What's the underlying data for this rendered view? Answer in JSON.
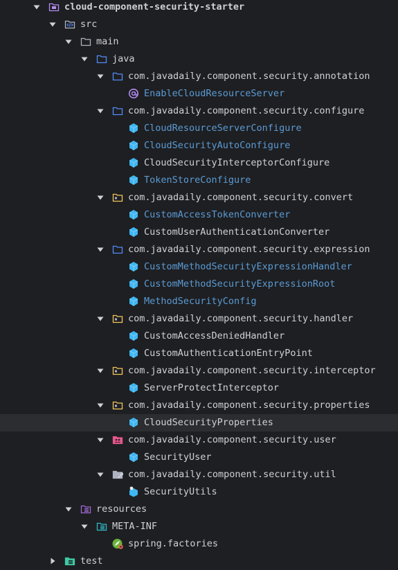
{
  "tree": {
    "nodes": [
      {
        "label": "cloud-component-security-starter",
        "icon": "module-folder-icon",
        "expand": "expanded",
        "level": 0,
        "color": "white",
        "bold": true
      },
      {
        "label": "src",
        "icon": "source-folder-icon",
        "expand": "expanded",
        "level": 1,
        "color": "white"
      },
      {
        "label": "main",
        "icon": "folder-icon",
        "expand": "expanded",
        "level": 2,
        "color": "white"
      },
      {
        "label": "java",
        "icon": "java-source-root-icon",
        "expand": "expanded",
        "level": 3,
        "color": "white"
      },
      {
        "label": "com.javadaily.component.security.annotation",
        "icon": "package-icon",
        "expand": "expanded",
        "level": 4,
        "color": "white"
      },
      {
        "label": "EnableCloudResourceServer",
        "icon": "annotation-icon",
        "expand": "none",
        "level": 5,
        "color": "blue"
      },
      {
        "label": "com.javadaily.component.security.configure",
        "icon": "package-icon",
        "expand": "expanded",
        "level": 4,
        "color": "white"
      },
      {
        "label": "CloudResourceServerConfigure",
        "icon": "class-icon",
        "expand": "none",
        "level": 5,
        "color": "blue"
      },
      {
        "label": "CloudSecurityAutoConfigure",
        "icon": "class-icon",
        "expand": "none",
        "level": 5,
        "color": "blue"
      },
      {
        "label": "CloudSecurityInterceptorConfigure",
        "icon": "class-icon",
        "expand": "none",
        "level": 5,
        "color": "white"
      },
      {
        "label": "TokenStoreConfigure",
        "icon": "class-icon",
        "expand": "none",
        "level": 5,
        "color": "blue"
      },
      {
        "label": "com.javadaily.component.security.convert",
        "icon": "package-yellow-icon",
        "expand": "expanded",
        "level": 4,
        "color": "white"
      },
      {
        "label": "CustomAccessTokenConverter",
        "icon": "class-icon",
        "expand": "none",
        "level": 5,
        "color": "blue"
      },
      {
        "label": "CustomUserAuthenticationConverter",
        "icon": "class-icon",
        "expand": "none",
        "level": 5,
        "color": "white"
      },
      {
        "label": "com.javadaily.component.security.expression",
        "icon": "package-icon",
        "expand": "expanded",
        "level": 4,
        "color": "white"
      },
      {
        "label": "CustomMethodSecurityExpressionHandler",
        "icon": "class-icon",
        "expand": "none",
        "level": 5,
        "color": "blue"
      },
      {
        "label": "CustomMethodSecurityExpressionRoot",
        "icon": "class-icon",
        "expand": "none",
        "level": 5,
        "color": "blue"
      },
      {
        "label": "MethodSecurityConfig",
        "icon": "class-icon",
        "expand": "none",
        "level": 5,
        "color": "blue"
      },
      {
        "label": "com.javadaily.component.security.handler",
        "icon": "package-yellow-icon",
        "expand": "expanded",
        "level": 4,
        "color": "white"
      },
      {
        "label": "CustomAccessDeniedHandler",
        "icon": "class-icon",
        "expand": "none",
        "level": 5,
        "color": "white"
      },
      {
        "label": "CustomAuthenticationEntryPoint",
        "icon": "class-icon",
        "expand": "none",
        "level": 5,
        "color": "white"
      },
      {
        "label": "com.javadaily.component.security.interceptor",
        "icon": "package-yellow-icon",
        "expand": "expanded",
        "level": 4,
        "color": "white"
      },
      {
        "label": "ServerProtectInterceptor",
        "icon": "class-icon",
        "expand": "none",
        "level": 5,
        "color": "white"
      },
      {
        "label": "com.javadaily.component.security.properties",
        "icon": "package-yellow-icon",
        "expand": "expanded",
        "level": 4,
        "color": "white"
      },
      {
        "label": "CloudSecurityProperties",
        "icon": "class-icon",
        "expand": "none",
        "level": 5,
        "color": "white",
        "selected": true
      },
      {
        "label": "com.javadaily.component.security.user",
        "icon": "package-user-icon",
        "expand": "expanded",
        "level": 4,
        "color": "white"
      },
      {
        "label": "SecurityUser",
        "icon": "class-icon",
        "expand": "none",
        "level": 5,
        "color": "white"
      },
      {
        "label": "com.javadaily.component.security.util",
        "icon": "package-util-icon",
        "expand": "expanded",
        "level": 4,
        "color": "white"
      },
      {
        "label": "SecurityUtils",
        "icon": "class-util-icon",
        "expand": "none",
        "level": 5,
        "color": "white"
      },
      {
        "label": "resources",
        "icon": "resources-folder-icon",
        "expand": "expanded",
        "level": 2,
        "color": "white"
      },
      {
        "label": "META-INF",
        "icon": "meta-folder-icon",
        "expand": "expanded",
        "level": 3,
        "color": "white"
      },
      {
        "label": "spring.factories",
        "icon": "spring-factories-icon",
        "expand": "none",
        "level": 4,
        "color": "white"
      },
      {
        "label": "test",
        "icon": "test-folder-icon",
        "expand": "collapsed",
        "level": 1,
        "color": "white"
      }
    ]
  },
  "colors": {
    "background": "#1e1f22",
    "selected_row": "#2b2d30",
    "text": "#cfd1d6",
    "text_modified": "#5b9bd5",
    "arrow": "#cfd1d6",
    "folder_outline": "#aeb3c2",
    "package_blue": "#548af7",
    "package_yellow": "#f2c55c",
    "class_cyan": "#3fb6f2",
    "annotation_purple": "#b18cf2",
    "module_purple": "#b18cf2",
    "user_pink": "#e5578a",
    "resources_purple": "#a06ad6",
    "meta_teal": "#2fb9c6",
    "test_green": "#3ec9a5",
    "spring_green": "#6bb33c"
  }
}
